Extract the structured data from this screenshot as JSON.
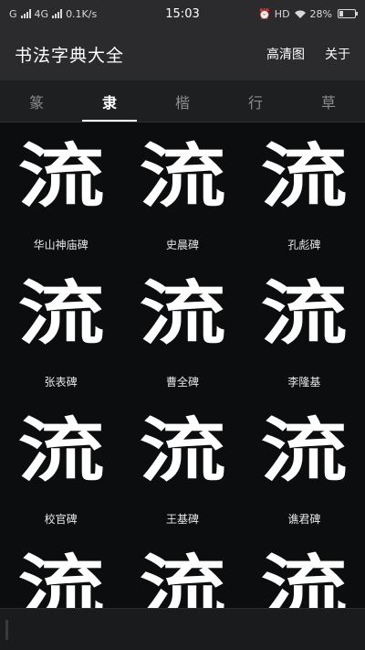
{
  "status_bar": {
    "carrier_left": "G",
    "network": "4G",
    "speed": "0.1K/s",
    "time": "15:03",
    "hd": "HD",
    "battery": "28%"
  },
  "app_bar": {
    "title": "书法字典大全",
    "hd_label": "高清图",
    "about_label": "关于"
  },
  "tabs": [
    {
      "label": "篆",
      "active": false
    },
    {
      "label": "隶",
      "active": true
    },
    {
      "label": "楷",
      "active": false
    },
    {
      "label": "行",
      "active": false
    },
    {
      "label": "草",
      "active": false
    }
  ],
  "character": "流",
  "items": [
    {
      "label": "华山神庙碑"
    },
    {
      "label": "史晨碑"
    },
    {
      "label": "孔彪碑"
    },
    {
      "label": "张表碑"
    },
    {
      "label": "曹全碑"
    },
    {
      "label": "李隆基"
    },
    {
      "label": "校官碑"
    },
    {
      "label": "王基碑"
    },
    {
      "label": "谯君碑"
    },
    {
      "label": ""
    },
    {
      "label": ""
    },
    {
      "label": ""
    }
  ]
}
